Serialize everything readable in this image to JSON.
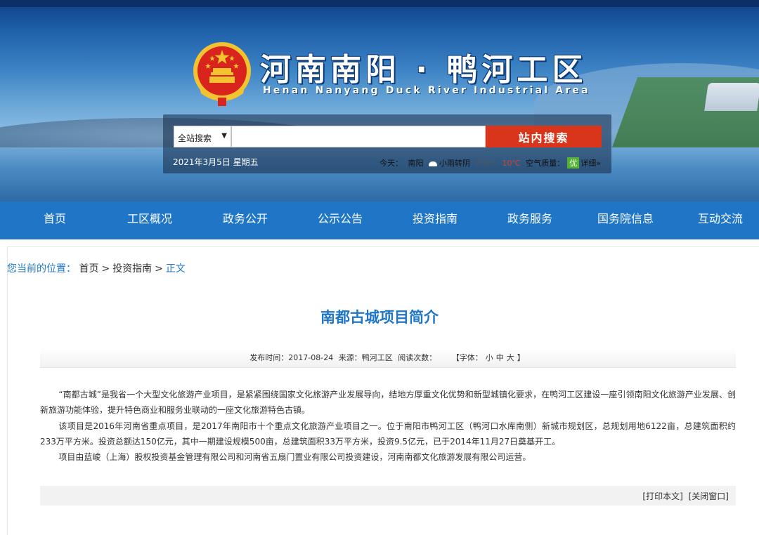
{
  "header": {
    "site_title": "河南南阳 · 鸭河工区",
    "site_subtitle": "Henan Nanyang Duck River Industrial Area",
    "search": {
      "scope_value": "全站搜索",
      "input_placeholder": "",
      "button_label": "站内搜索"
    },
    "date": "2021年3月5日 星期五",
    "weather": {
      "label": "今天：",
      "city": "南阳",
      "condition": "小雨转阴",
      "temp_range": "2℃～",
      "aqi_value": "10℃",
      "aqi_label": "空气质量：",
      "aqi_level": "优",
      "detail_link": "详细»"
    },
    "colors": {
      "nav": "#1f76c7",
      "search_button": "#d9351a",
      "title": "#1f76c7"
    }
  },
  "nav": {
    "items": [
      {
        "label": "首页"
      },
      {
        "label": "工区概况"
      },
      {
        "label": "政务公开"
      },
      {
        "label": "公示公告"
      },
      {
        "label": "投资指南"
      },
      {
        "label": "政务服务"
      },
      {
        "label": "国务院信息"
      },
      {
        "label": "互动交流"
      }
    ]
  },
  "breadcrumb": {
    "label": "您当前的位置：",
    "items": [
      "首页",
      "投资指南",
      "正文"
    ],
    "separator": ">"
  },
  "article": {
    "title": "南都古城项目简介",
    "meta": {
      "publish_time": "发布时间：2017-08-24",
      "source": "来源：鸭河工区",
      "read_count": "阅读次数：",
      "font_label": "【字体：",
      "font_small": "小",
      "font_medium": "中",
      "font_large": "大",
      "font_end": "】"
    },
    "paragraphs": [
      "“南都古城”是我省一个大型文化旅游产业项目，是紧紧围绕国家文化旅游产业发展导向，结地方厚重文化优势和新型城镇化要求，在鸭河工区建设一座引领南阳文化旅游产业发展、创新旅游功能体验，提升特色商业和服务业联动的一座文化旅游特色古镇。",
      "该项目是2016年河南省重点项目，是2017年南阳市十个重点文化旅游产业项目之一。位于南阳市鸭河工区（鸭河口水库南侧）新城市规划区，总规划用地6122亩，总建筑面积约233万平方米。投资总额达150亿元，其中一期建设规模500亩，总建筑面积33万平方米，投资9.5亿元，已于2014年11月27日奠基开工。",
      "项目由蓝峻（上海）股权投资基金管理有限公司和河南省五扇门置业有限公司投资建设，河南南都文化旅游发展有限公司运营。"
    ],
    "print_link": "[打印本文]",
    "close_link": "[关闭窗口]"
  }
}
